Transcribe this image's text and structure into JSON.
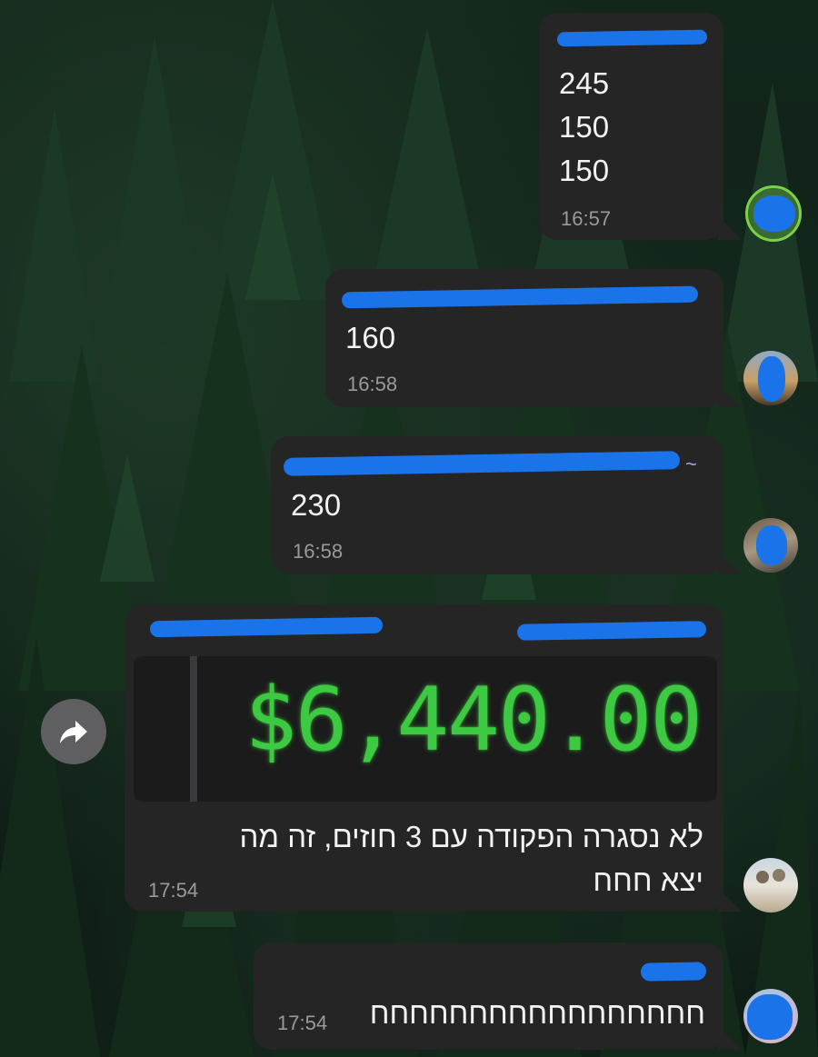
{
  "messages": [
    {
      "lines": [
        "245",
        "150",
        "150"
      ],
      "time": "16:57"
    },
    {
      "lines": [
        "160"
      ],
      "time": "16:58"
    },
    {
      "lines": [
        "230"
      ],
      "time": "16:58"
    },
    {
      "quoted_amount": "$6,440.00",
      "lines": [
        "לא נסגרה הפקודה עם 3 חוזים, זה מה",
        "יצא חחח"
      ],
      "time": "17:54"
    },
    {
      "lines": [
        "חחחחחחחחחחחחחחחחח"
      ],
      "time": "17:54"
    }
  ],
  "sender_tilde": "~",
  "icons": {
    "forward": "forward-arrow-icon"
  },
  "colors": {
    "bubble": "#252526",
    "redaction": "#1a73e8",
    "amount_green": "#3ec942",
    "timestamp": "#9a9a9a"
  }
}
